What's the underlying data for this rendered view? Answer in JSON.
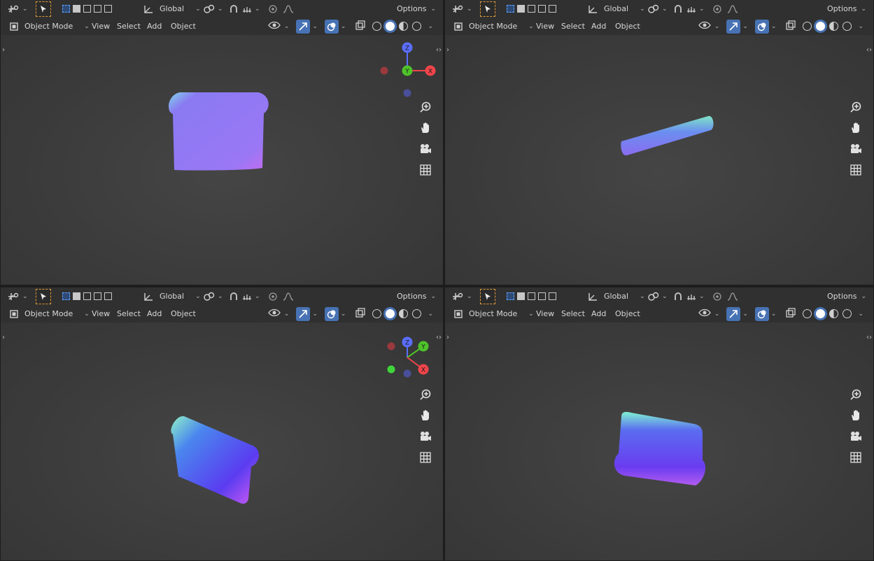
{
  "header": {
    "orientation_label": "Global",
    "options_label": "Options",
    "mode_label": "Object Mode",
    "menus": [
      "View",
      "Select",
      "Add",
      "Object"
    ]
  },
  "gizmo_labels": {
    "x": "X",
    "y": "Y",
    "z": "Z"
  },
  "viewports": [
    {
      "name": "top-left",
      "object": "toast front view"
    },
    {
      "name": "top-right",
      "object": "toast top view"
    },
    {
      "name": "bottom-left",
      "object": "toast perspective view"
    },
    {
      "name": "bottom-right",
      "object": "toast back perspective view"
    }
  ],
  "colors": {
    "x_axis": "#f0454b",
    "y_axis": "#4ec32a",
    "z_axis": "#5b6eff",
    "select_accent": "#e09a3a",
    "active_blue": "#4772b3"
  },
  "icons": [
    "editor-type-icon",
    "select-tool-icon",
    "transform-orientation-icon",
    "snap-icon",
    "proportional-edit-icon",
    "visibility-icon",
    "gizmo-icon",
    "overlay-icon",
    "xray-icon",
    "wireframe-shading-icon",
    "solid-shading-icon",
    "material-shading-icon",
    "rendered-shading-icon",
    "zoom-icon",
    "pan-hand-icon",
    "camera-icon",
    "grid-icon"
  ]
}
